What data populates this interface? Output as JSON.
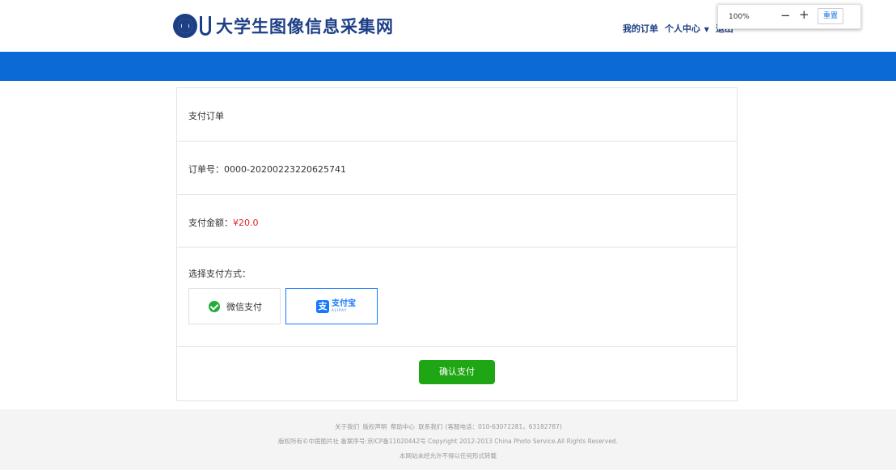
{
  "header": {
    "logo_text": "大学生图像信息采集网",
    "nav": {
      "my_orders": "我的订单",
      "user_center": "个人中心",
      "logout": "退出"
    }
  },
  "zoom_popup": {
    "level": "100%",
    "minus": "−",
    "plus": "+",
    "reset": "重置"
  },
  "order": {
    "title": "支付订单",
    "order_no_label": "订单号：",
    "order_no": "0000-20200223220625741",
    "amount_label": "支付金额：",
    "amount": "¥20.0",
    "method_label": "选择支付方式：",
    "methods": {
      "wechat": "微信支付",
      "alipay_cn": "支付宝",
      "alipay_en": "ALIPAY"
    },
    "selected_method": "alipay",
    "confirm": "确认支付"
  },
  "footer": {
    "links": [
      "关于我们",
      "版权声明",
      "帮助中心",
      "联系我们"
    ],
    "hotline": "(客服电话：010-63072281，63182787)",
    "copyright": "版权所有©中国图片社 备案序号:京ICP备11020442号 Copyright 2012-2013 China Photo Service.All Rights Reserved.",
    "notice": "本网站未经允许不得以任何形式转载"
  },
  "colors": {
    "brand_blue": "#1d3f86",
    "band_blue": "#0c6ad6",
    "confirm_green": "#1ea614",
    "amount_red": "#e02020",
    "alipay_blue": "#1677ff",
    "wechat_green": "#22ac38"
  }
}
